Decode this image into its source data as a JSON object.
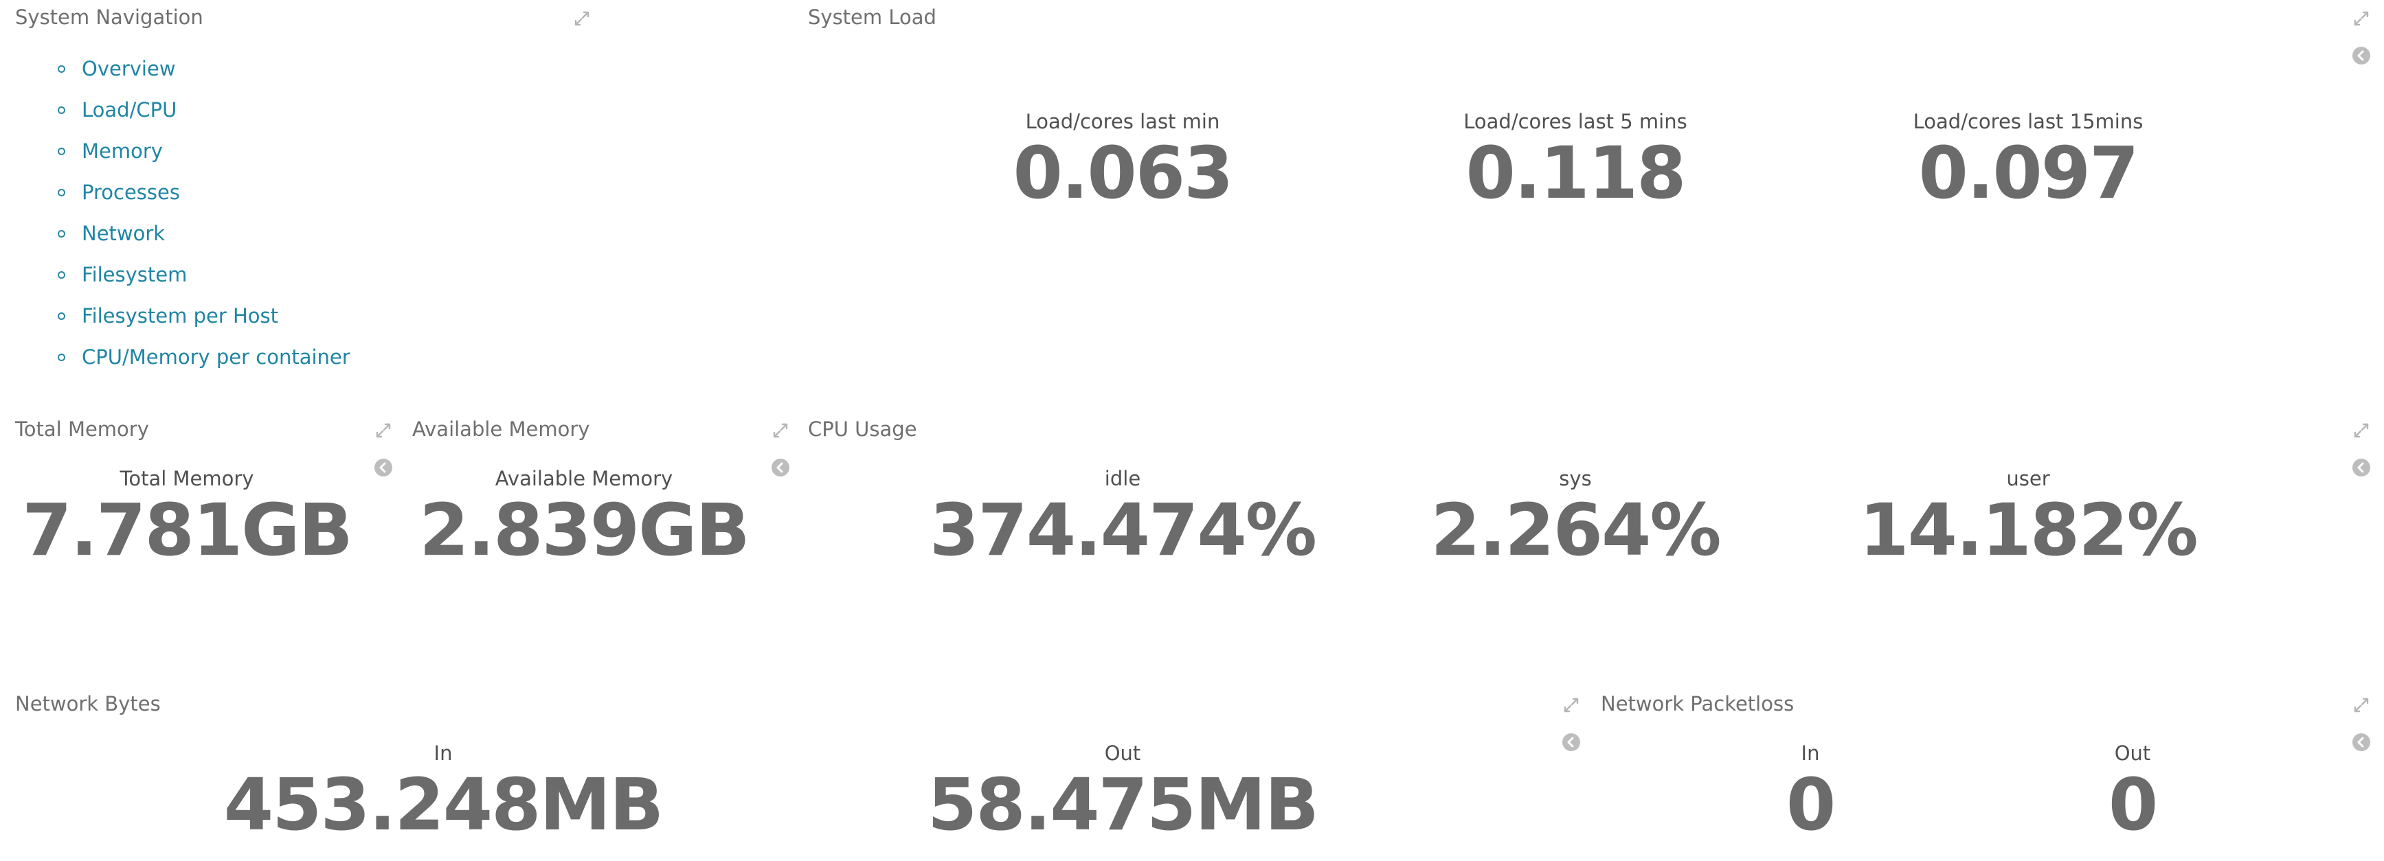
{
  "colors": {
    "link": "#1f85a5",
    "panel_title": "#6f6f6f",
    "metric_value": "#6b6b6b",
    "metric_label": "#505050",
    "icon": "#b5b5b5"
  },
  "icons": {
    "expand": "expand-arrows-icon",
    "collapse": "chevron-left-circle-icon"
  },
  "system_navigation": {
    "title": "System Navigation",
    "links": [
      {
        "label": "Overview"
      },
      {
        "label": "Load/CPU"
      },
      {
        "label": "Memory"
      },
      {
        "label": "Processes"
      },
      {
        "label": "Network"
      },
      {
        "label": "Filesystem"
      },
      {
        "label": "Filesystem per Host"
      },
      {
        "label": "CPU/Memory per container"
      }
    ]
  },
  "system_load": {
    "title": "System Load",
    "metrics": [
      {
        "label": "Load/cores last min",
        "value": "0.063"
      },
      {
        "label": "Load/cores last 5 mins",
        "value": "0.118"
      },
      {
        "label": "Load/cores last 15mins",
        "value": "0.097"
      }
    ]
  },
  "total_memory": {
    "title": "Total Memory",
    "metric": {
      "label": "Total Memory",
      "value": "7.781GB"
    }
  },
  "available_memory": {
    "title": "Available Memory",
    "metric": {
      "label": "Available Memory",
      "value": "2.839GB"
    }
  },
  "cpu_usage": {
    "title": "CPU Usage",
    "metrics": [
      {
        "label": "idle",
        "value": "374.474%"
      },
      {
        "label": "sys",
        "value": "2.264%"
      },
      {
        "label": "user",
        "value": "14.182%"
      }
    ]
  },
  "network_bytes": {
    "title": "Network Bytes",
    "metrics": [
      {
        "label": "In",
        "value": "453.248MB"
      },
      {
        "label": "Out",
        "value": "58.475MB"
      }
    ]
  },
  "network_packetloss": {
    "title": "Network Packetloss",
    "metrics": [
      {
        "label": "In",
        "value": "0"
      },
      {
        "label": "Out",
        "value": "0"
      }
    ]
  }
}
